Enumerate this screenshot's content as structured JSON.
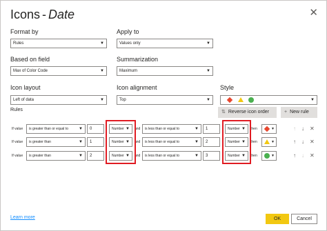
{
  "dialog": {
    "title": "Icons",
    "title_sep": "-",
    "title_field": "Date",
    "close_icon": "close-icon"
  },
  "format_by": {
    "label": "Format by",
    "value": "Rules"
  },
  "apply_to": {
    "label": "Apply to",
    "value": "Values only"
  },
  "based_on_field": {
    "label": "Based on field",
    "value": "Max of Color Code"
  },
  "summarization": {
    "label": "Summarization",
    "value": "Maximum"
  },
  "icon_layout": {
    "label": "Icon layout",
    "value": "Left of data"
  },
  "icon_alignment": {
    "label": "Icon alignment",
    "value": "Top"
  },
  "style": {
    "label": "Style",
    "icons": [
      "diamond-icon",
      "triangle-icon",
      "circle-icon"
    ],
    "colors": {
      "red": "#e8462d",
      "yellow": "#f2c811",
      "green": "#4ab04f"
    }
  },
  "rules": {
    "label": "Rules",
    "reverse_button": "Reverse icon order",
    "new_rule_button": "New rule",
    "rows": [
      {
        "if_value": "If value",
        "op1": "is greater than or equal to",
        "val1": "0",
        "type1": "Number",
        "and": "and",
        "op2": "is less than or equal to",
        "val2": "1",
        "type2": "Number",
        "then": "then",
        "icon": "diamond-icon"
      },
      {
        "if_value": "If value",
        "op1": "is greater than",
        "val1": "1",
        "type1": "Number",
        "and": "and",
        "op2": "is less than or equal to",
        "val2": "2",
        "type2": "Number",
        "then": "then",
        "icon": "triangle-icon"
      },
      {
        "if_value": "If value",
        "op1": "is greater than",
        "val1": "2",
        "type1": "Number",
        "and": "and",
        "op2": "is less than or equal to",
        "val2": "3",
        "type2": "Number",
        "then": "then",
        "icon": "circle-icon"
      }
    ]
  },
  "footer": {
    "learn_more": "Learn more",
    "ok": "OK",
    "cancel": "Cancel"
  },
  "highlight_color": "#e01b22"
}
